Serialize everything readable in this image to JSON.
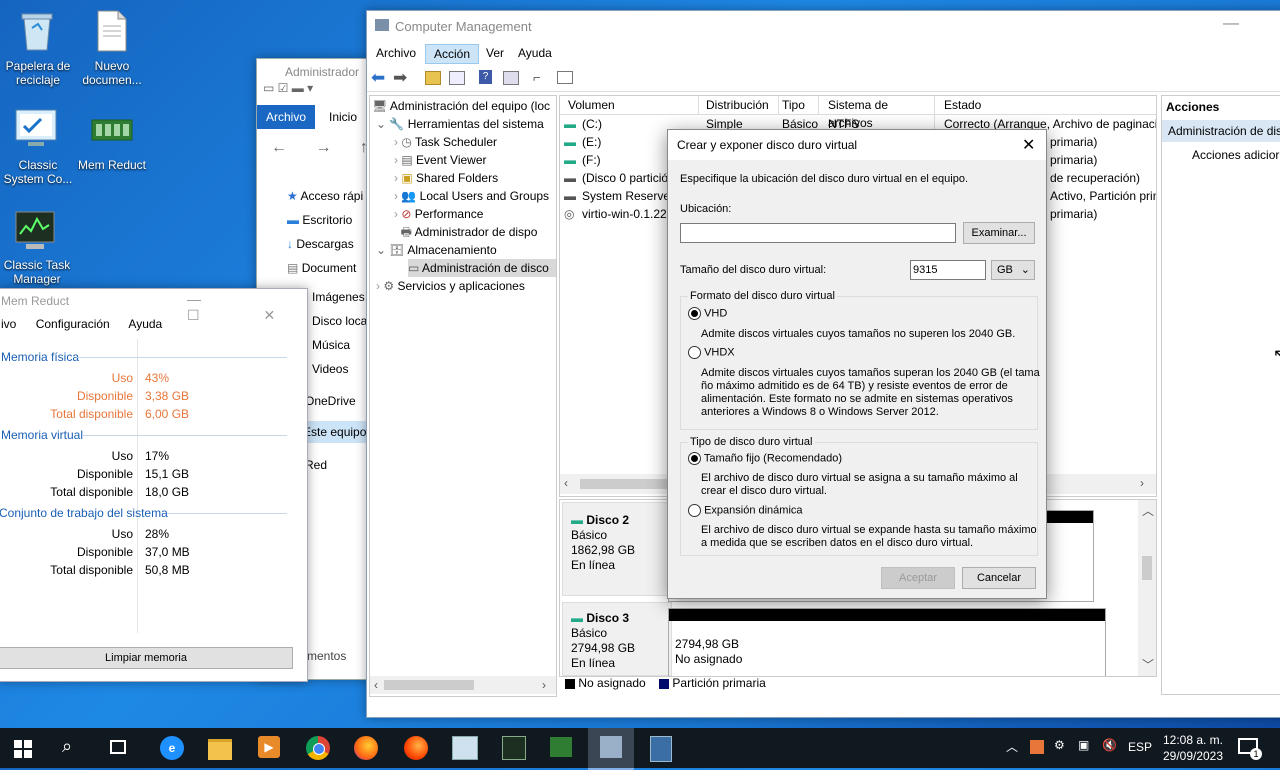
{
  "desktop": {
    "icons": [
      {
        "label": "Papelera de reciclaje"
      },
      {
        "label": "Nuevo documen..."
      },
      {
        "label": "Classic System Co..."
      },
      {
        "label": "Mem Reduct"
      },
      {
        "label": "Classic Task Manager"
      }
    ]
  },
  "explorer": {
    "title": "Administrador",
    "tabs": [
      "Archivo",
      "Inicio"
    ],
    "nav": [
      "Acceso rápi",
      "Escritorio",
      "Descargas",
      "Document",
      "Imágenes",
      "Disco loca",
      "Música",
      "Videos",
      "OneDrive",
      "Este equipo",
      "Red"
    ],
    "footer": "mentos"
  },
  "memreduct": {
    "title": "Mem Reduct",
    "menu": [
      "ivo",
      "Configuración",
      "Ayuda"
    ],
    "sections": [
      {
        "title": "Memoria física",
        "rows": [
          [
            "Uso",
            "43%"
          ],
          [
            "Disponible",
            "3,38 GB"
          ],
          [
            "Total disponible",
            "6,00 GB"
          ]
        ]
      },
      {
        "title": "Memoria virtual",
        "rows": [
          [
            "Uso",
            "17%"
          ],
          [
            "Disponible",
            "15,1 GB"
          ],
          [
            "Total disponible",
            "18,0 GB"
          ]
        ]
      },
      {
        "title": "Conjunto de trabajo del sistema",
        "rows": [
          [
            "Uso",
            "28%"
          ],
          [
            "Disponible",
            "37,0 MB"
          ],
          [
            "Total disponible",
            "50,8 MB"
          ]
        ]
      }
    ],
    "button": "Limpiar memoria",
    "accent": "#e8763a"
  },
  "cm": {
    "title": "Computer Management",
    "menu": [
      "Archivo",
      "Acción",
      "Ver",
      "Ayuda"
    ],
    "tree": [
      "Administración del equipo (loc",
      "Herramientas del sistema",
      "Task Scheduler",
      "Event Viewer",
      "Shared Folders",
      "Local Users and Groups",
      "Performance",
      "Administrador de dispo",
      "Almacenamiento",
      "Administración de disco",
      "Servicios y aplicaciones"
    ],
    "columns": [
      "Volumen",
      "Distribución",
      "Tipo",
      "Sistema de archivos",
      "Estado"
    ],
    "volumes": [
      [
        "(C:)",
        "Simple",
        "Básico",
        "NTFS",
        "Correcto (Arranque, Archivo de paginaci"
      ],
      [
        "(E:)",
        "",
        "",
        "",
        "primaria)"
      ],
      [
        "(F:)",
        "",
        "",
        "",
        "primaria)"
      ],
      [
        "(Disco 0 partició",
        "",
        "",
        "",
        "de recuperación)"
      ],
      [
        "System Reserved",
        "",
        "",
        "",
        "Activo, Partición prim"
      ],
      [
        "virtio-win-0.1.22",
        "",
        "",
        "",
        "primaria)"
      ]
    ],
    "disks": [
      {
        "name": "Disco 2",
        "type": "Básico",
        "size": "1862,98 GB",
        "status": "En línea"
      },
      {
        "name": "Disco 3",
        "type": "Básico",
        "size": "2794,98 GB",
        "status": "En línea",
        "part_size": "2794,98 GB",
        "part_status": "No asignado"
      }
    ],
    "legend": [
      "No asignado",
      "Partición primaria"
    ],
    "actions_title": "Acciones",
    "actions": [
      "Administración de dis",
      "Acciones adicior"
    ]
  },
  "dialog": {
    "title": "Crear y exponer disco duro virtual",
    "intro": "Especifique la ubicación del disco duro virtual en el equipo.",
    "location_label": "Ubicación:",
    "location_value": "",
    "browse": "Examinar...",
    "size_label": "Tamaño del disco duro virtual:",
    "size_value": "9315",
    "unit": "GB",
    "format_group": "Formato del disco duro virtual",
    "vhd": "VHD",
    "vhd_desc": "Admite discos virtuales cuyos tamaños no superen los 2040 GB.",
    "vhdx": "VHDX",
    "vhdx_desc_1": "Admite discos virtuales cuyos tamaños superan los 2040 GB (el tama",
    "vhdx_desc_2": "ño máximo admitido es de 64 TB) y resiste eventos de error de",
    "vhdx_desc_3": "alimentación. Este formato no se admite en sistemas operativos",
    "vhdx_desc_4": "anteriores a Windows 8 o Windows Server 2012.",
    "type_group": "Tipo de disco duro virtual",
    "fixed": "Tamaño fijo (Recomendado)",
    "fixed_desc_1": "El archivo de disco duro virtual se asigna a su tamaño máximo al",
    "fixed_desc_2": "crear el disco duro virtual.",
    "dynamic": "Expansión dinámica",
    "dynamic_desc_1": "El archivo de disco duro virtual se expande hasta su tamaño máximo",
    "dynamic_desc_2": "a medida que se escriben datos en el disco duro virtual.",
    "accept": "Aceptar",
    "cancel": "Cancelar"
  },
  "taskbar": {
    "lang": "ESP",
    "time": "12:08 a. m.",
    "date": "29/09/2023",
    "notif_count": "1"
  }
}
